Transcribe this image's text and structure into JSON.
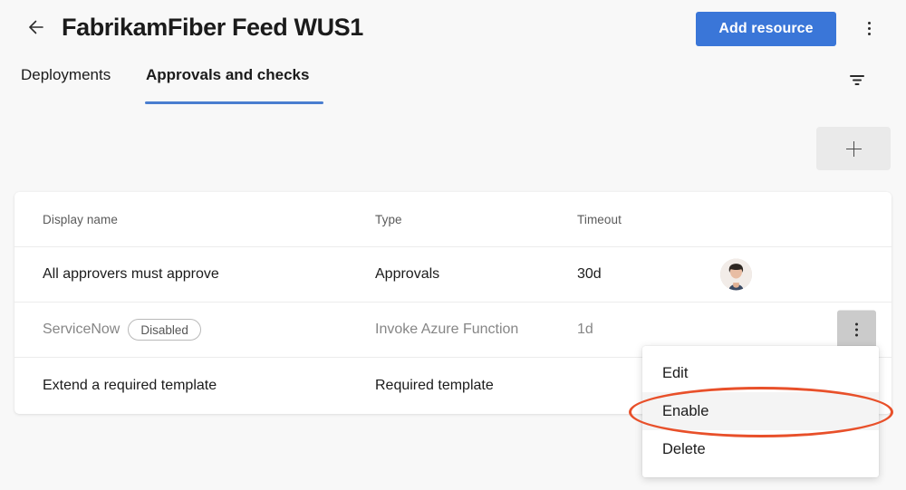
{
  "header": {
    "back_icon": "arrow-left-icon",
    "title": "FabrikamFiber Feed WUS1",
    "add_resource_label": "Add resource",
    "kebab_icon": "more-vertical-icon",
    "accent_color": "#3a76d8"
  },
  "tabs": {
    "items": [
      {
        "label": "Deployments",
        "active": false
      },
      {
        "label": "Approvals and checks",
        "active": true
      }
    ],
    "active_underline_color": "#4a7ed0",
    "filter_icon": "filter-icon"
  },
  "toolbar": {
    "add_check_icon": "plus-icon",
    "add_check_label": "+"
  },
  "table": {
    "columns": [
      "Display name",
      "Type",
      "Timeout"
    ],
    "rows": [
      {
        "display_name": "All approvers must approve",
        "badge": "",
        "type": "Approvals",
        "timeout": "30d",
        "disabled": false,
        "has_avatar": true,
        "avatar_name": "approver-avatar"
      },
      {
        "display_name": "ServiceNow",
        "badge": "Disabled",
        "type": "Invoke Azure Function",
        "timeout": "1d",
        "disabled": true,
        "has_avatar": false,
        "kebab_icon": "more-vertical-icon"
      },
      {
        "display_name": "Extend a required template",
        "badge": "",
        "type": "Required template",
        "timeout": "",
        "disabled": false,
        "has_avatar": false
      }
    ]
  },
  "context_menu": {
    "items": [
      {
        "label": "Edit",
        "hovered": false
      },
      {
        "label": "Enable",
        "hovered": true
      },
      {
        "label": "Delete",
        "hovered": false
      }
    ]
  },
  "annotation": {
    "target": "Enable",
    "shape": "ellipse",
    "color": "#e8502a"
  }
}
